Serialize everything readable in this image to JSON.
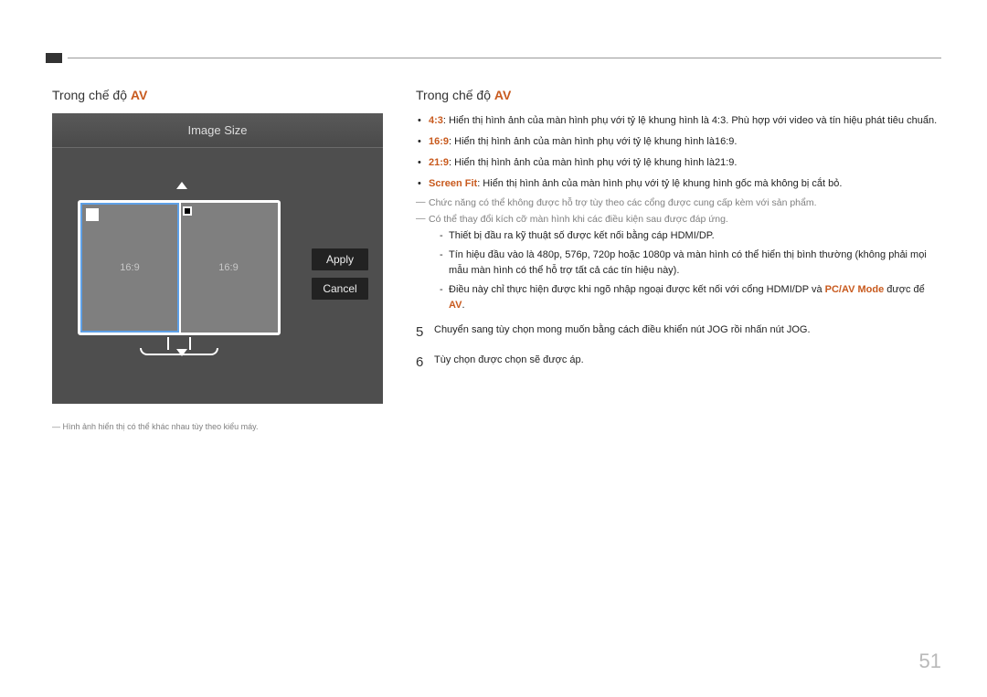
{
  "page_number": "51",
  "left": {
    "heading_prefix": "Trong chế độ ",
    "heading_accent": "AV",
    "osd_title": "Image Size",
    "panel_left_label": "16:9",
    "panel_right_label": "16:9",
    "apply_label": "Apply",
    "cancel_label": "Cancel",
    "footnote": "Hình ảnh hiển thị có thể khác nhau tùy theo kiểu máy."
  },
  "right": {
    "heading_prefix": "Trong chế độ ",
    "heading_accent": "AV",
    "bullets": [
      {
        "accent": "4:3",
        "text": ": Hiển thị hình ảnh của màn hình phụ với tỷ lệ khung hình là 4:3. Phù hợp với video và tín hiệu phát tiêu chuẩn."
      },
      {
        "accent": "16:9",
        "text": ": Hiển thị hình ảnh của màn hình phụ với tỷ lệ khung hình là16:9."
      },
      {
        "accent": "21:9",
        "text": ": Hiển thị hình ảnh của màn hình phụ với tỷ lệ khung hình là21:9."
      },
      {
        "accent": "Screen Fit",
        "text": ": Hiển thị hình ảnh của màn hình phụ với tỷ lệ khung hình gốc mà không bị cắt bỏ."
      }
    ],
    "note1": "Chức năng có thể không được hỗ trợ tùy theo các cổng được cung cấp kèm với sản phẩm.",
    "note2": "Có thể thay đổi kích cỡ màn hình khi các điều kiện sau được đáp ứng.",
    "dash": [
      "Thiết bị đầu ra kỹ thuật số được kết nối bằng cáp HDMI/DP.",
      "Tín hiệu đầu vào là 480p, 576p, 720p hoặc 1080p và màn hình có thể hiển thị bình thường (không phải mọi mẫu màn hình có thể hỗ trợ tất cả các tín hiệu này)."
    ],
    "dash3_pre": "Điều này chỉ thực hiện được khi ngõ nhập ngoại được kết nối với cổng HDMI/DP và ",
    "dash3_accent": "PC/AV Mode",
    "dash3_post": " được để ",
    "dash3_accent2": "AV",
    "dash3_end": ".",
    "step5": "Chuyển sang tùy chọn mong muốn bằng cách điều khiển nút JOG rồi nhấn nút JOG.",
    "step6": "Tùy chọn được chọn sẽ được áp."
  }
}
